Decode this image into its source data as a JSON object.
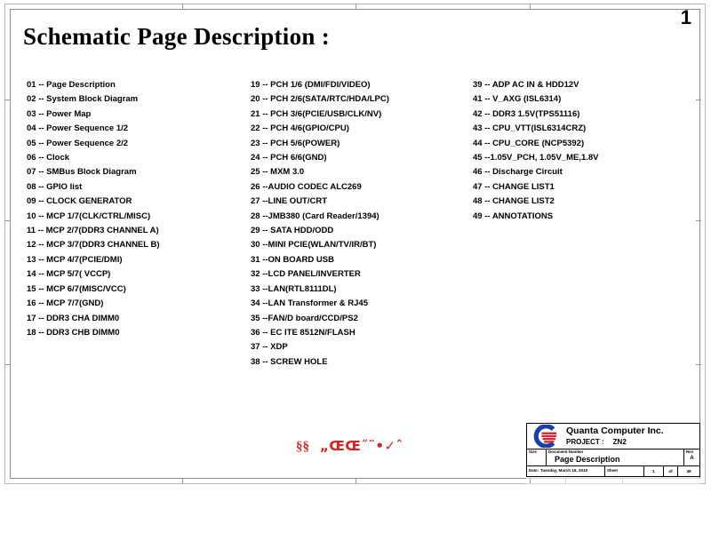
{
  "page": {
    "number": "1",
    "title": "Schematic Page Description :"
  },
  "index": {
    "column_1": [
      "01 -- Page Description",
      "02 -- System Block Diagram",
      "03 -- Power Map",
      "04 -- Power Sequence 1/2",
      "05 -- Power Sequence 2/2",
      "06 -- Clock",
      "07 -- SMBus Block Diagram",
      "08 -- GPIO list",
      "09 -- CLOCK GENERATOR",
      "10 -- MCP 1/7(CLK/CTRL/MISC)",
      "11 -- MCP 2/7(DDR3 CHANNEL A)",
      "12 -- MCP 3/7(DDR3 CHANNEL B)",
      "13 -- MCP 4/7(PCIE/DMI)",
      "14 -- MCP 5/7( VCCP)",
      "15 -- MCP 6/7(MISC/VCC)",
      "16 -- MCP 7/7(GND)",
      "17 -- DDR3 CHA DIMM0",
      "18 -- DDR3 CHB DIMM0"
    ],
    "column_2": [
      "19 -- PCH 1/6 (DMI/FDI/VIDEO)",
      "20 -- PCH 2/6(SATA/RTC/HDA/LPC)",
      "21 -- PCH 3/6(PCIE/USB/CLK/NV)",
      "22 -- PCH 4/6(GPIO/CPU)",
      "23 -- PCH 5/6(POWER)",
      "24 -- PCH 6/6(GND)",
      "25 -- MXM 3.0",
      "26 --AUDIO CODEC ALC269",
      "27 --LINE OUT/CRT",
      "28 --JMB380 (Card Reader/1394)",
      "29 -- SATA HDD/ODD",
      "30 --MINI PCIE(WLAN/TV/IR/BT)",
      "31 --ON BOARD USB",
      "32 --LCD PANEL/INVERTER",
      "33 --LAN(RTL8111DL)",
      "34 --LAN Transformer & RJ45",
      "35 --FAN/D board/CCD/PS2",
      "36 -- EC ITE 8512N/FLASH",
      "37 -- XDP",
      "38 -- SCREW HOLE"
    ],
    "column_3": [
      "39 -- ADP AC IN & HDD12V",
      "41 -- V_AXG (ISL6314)",
      "42 -- DDR3 1.5V(TPS51116)",
      "43 -- CPU_VTT(ISL6314CRZ)",
      "44 -- CPU_CORE (NCP5392)",
      "45 --1.05V_PCH, 1.05V_ME,1.8V",
      "46 -- Discharge Circuit",
      "47 -- CHANGE LIST1",
      "48 -- CHANGE LIST2",
      "49 -- ANNOTATIONS"
    ]
  },
  "annotation": {
    "section_mark": "§§",
    "garbled_mark": "„ŒŒ˝¨•✓ˆ"
  },
  "title_block": {
    "company": "Quanta Computer Inc.",
    "project_label": "PROJECT  :",
    "project_value": "ZN2",
    "size_caption": "Size",
    "size_value": "",
    "document_number_caption": "Document Number",
    "document_number_value": "Page Description",
    "rev_caption": "Rev",
    "rev_value": "A",
    "date_caption": "Date:",
    "date_value": "Tuesday, March 16, 2010",
    "sheet_caption": "Sheet",
    "sheet_value": "1",
    "of_caption": "of",
    "of_value": "49"
  },
  "colors": {
    "logo_blue": "#1a3faa",
    "logo_red": "#d9232e",
    "annotation_red": "#e02020",
    "frame": "#8e8e8e"
  }
}
